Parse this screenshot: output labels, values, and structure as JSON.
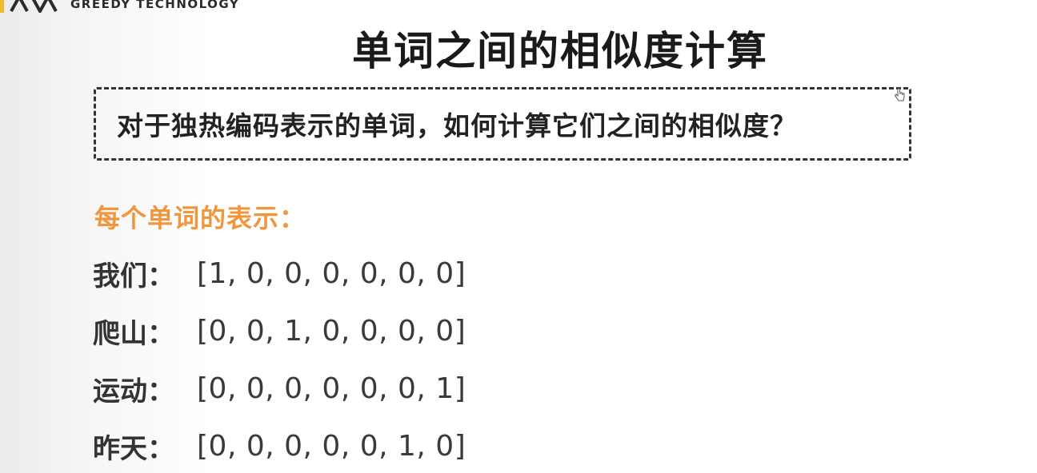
{
  "brand": {
    "name": "GREEDY TECHNOLOGY"
  },
  "slide": {
    "title": "单词之间的相似度计算",
    "question": "对于独热编码表示的单词，如何计算它们之间的相似度？",
    "section_heading": "每个单词的表示："
  },
  "words": [
    {
      "label": "我们：",
      "vector": "[1, 0, 0, 0, 0, 0, 0]"
    },
    {
      "label": "爬山：",
      "vector": "[0, 0, 1, 0, 0, 0, 0]"
    },
    {
      "label": "运动：",
      "vector": "[0, 0, 0, 0, 0, 0, 1]"
    },
    {
      "label": "昨天：",
      "vector": "[0, 0, 0, 0, 0, 1, 0]"
    }
  ],
  "colors": {
    "accent": "#f0963c",
    "text": "#333333"
  }
}
